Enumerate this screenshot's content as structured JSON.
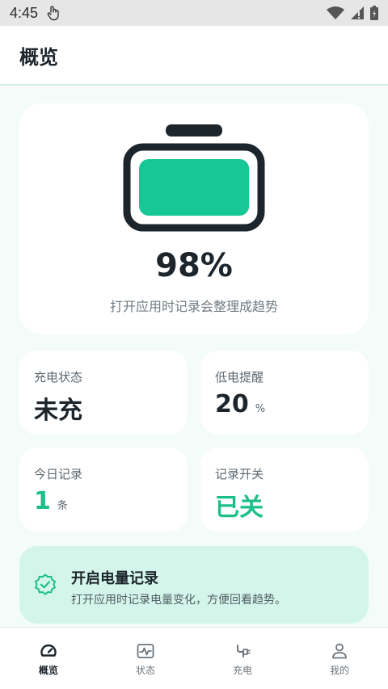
{
  "status_bar": {
    "time": "4:45"
  },
  "header": {
    "title": "概览"
  },
  "overview": {
    "battery_level": 0.98,
    "percent_text": "98%",
    "hint": "打开应用时记录会整理成趋势"
  },
  "cards": {
    "charge_state": {
      "label": "充电状态",
      "value": "未充"
    },
    "low_alert": {
      "label": "低电提醒",
      "value": "20",
      "unit": "%"
    },
    "today_records": {
      "label": "今日记录",
      "value": "1",
      "unit": "条"
    },
    "record_switch": {
      "label": "记录开关",
      "value": "已关"
    }
  },
  "cta": {
    "title": "开启电量记录",
    "subtitle": "打开应用时记录电量变化，方便回看趋势。",
    "icon": "check-badge-icon"
  },
  "bottom_nav": {
    "items": [
      {
        "label": "概览",
        "icon": "gauge-icon",
        "active": true
      },
      {
        "label": "状态",
        "icon": "pulse-icon",
        "active": false
      },
      {
        "label": "充电",
        "icon": "plug-icon",
        "active": false
      },
      {
        "label": "我的",
        "icon": "person-icon",
        "active": false
      }
    ]
  },
  "colors": {
    "accent": "#1bbf8a",
    "battery_fill": "#17c796",
    "background": "#f3fcf8",
    "cta_background": "#d4f6ea",
    "text_dark": "#1d252c"
  }
}
